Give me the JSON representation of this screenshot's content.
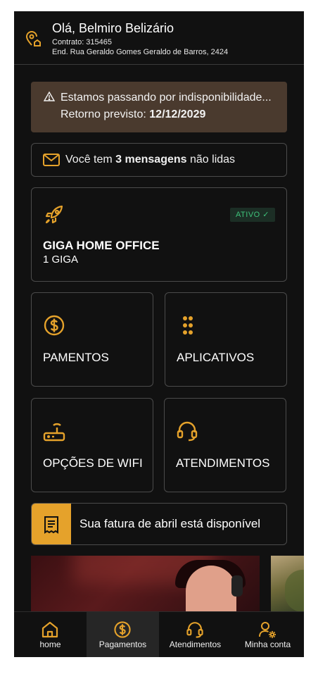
{
  "header": {
    "greeting": "Olá, Belmiro Belizário",
    "contract": "Contrato: 315465",
    "address": "End. Rua Geraldo Gomes Geraldo de Barros, 2424"
  },
  "alert": {
    "line1": "Estamos passando por indisponibilidade...",
    "line2_label": "Retorno previsto: ",
    "line2_date": "12/12/2029"
  },
  "messages": {
    "prefix": "Você tem ",
    "count_text": "3 mensagens",
    "suffix": " não lidas"
  },
  "plan": {
    "status": "ATIVO ✓",
    "name": "GIGA HOME OFFICE",
    "speed": "1 GIGA"
  },
  "tiles": [
    {
      "label": "PAMENTOS",
      "icon": "dollar-icon"
    },
    {
      "label": "APLICATIVOS",
      "icon": "apps-grid-icon"
    },
    {
      "label": "OPÇÕES DE WIFI",
      "icon": "router-icon"
    },
    {
      "label": "ATENDIMENTOS",
      "icon": "headset-icon"
    }
  ],
  "invoice": {
    "text": "Sua fatura de abril está disponível"
  },
  "nav": [
    {
      "label": "home",
      "icon": "home-icon"
    },
    {
      "label": "Pagamentos",
      "icon": "dollar-icon"
    },
    {
      "label": "Atendimentos",
      "icon": "headset-icon"
    },
    {
      "label": "Minha conta",
      "icon": "user-settings-icon"
    }
  ],
  "colors": {
    "accent": "#e5a22b",
    "background": "#111111",
    "alert_bg": "#4a3a2e",
    "active_badge": "#3ec27a"
  }
}
